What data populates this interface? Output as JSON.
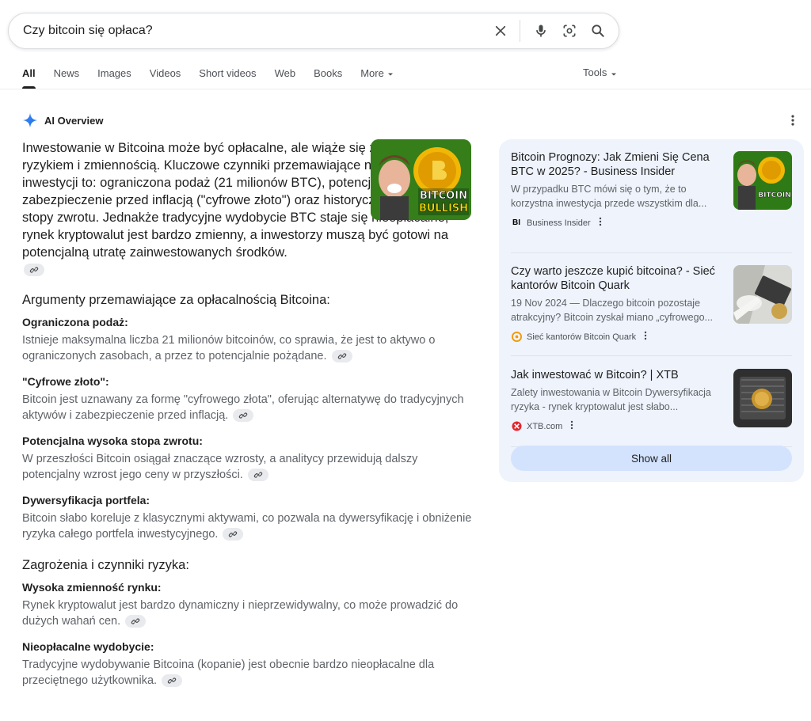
{
  "search": {
    "query": "Czy bitcoin się opłaca?"
  },
  "tabs": [
    "All",
    "News",
    "Images",
    "Videos",
    "Short videos",
    "Web",
    "Books",
    "More"
  ],
  "tools_label": "Tools",
  "ai_overview": {
    "label": "AI Overview",
    "intro": "Inwestowanie w Bitcoina może być opłacalne, ale wiąże się z wysokim ryzykiem i zmiennością. Kluczowe czynniki przemawiające na korzyść inwestycji to: ograniczona podaż (21 milionów BTC), potencjał jako zabezpieczenie przed inflacją (\"cyfrowe złoto\") oraz historyczne wysokie stopy zwrotu. Jednakże tradycyjne wydobycie BTC staje się nieopłacalne, rynek kryptowalut jest bardzo zmienny, a inwestorzy muszą być gotowi na potencjalną utratę zainwestowanych środków.",
    "thumb_text": "BITCOIN BULLISH",
    "sections": [
      {
        "heading": "Argumenty przemawiające za opłacalnością Bitcoina:",
        "items": [
          {
            "title": "Ograniczona podaż:",
            "body": "Istnieje maksymalna liczba 21 milionów bitcoinów, co sprawia, że jest to aktywo o ograniczonych zasobach, a przez to potencjalnie pożądane."
          },
          {
            "title": "\"Cyfrowe złoto\":",
            "body": "Bitcoin jest uznawany za formę \"cyfrowego złota\", oferując alternatywę do tradycyjnych aktywów i zabezpieczenie przed inflacją."
          },
          {
            "title": "Potencjalna wysoka stopa zwrotu:",
            "body": "W przeszłości Bitcoin osiągał znaczące wzrosty, a analitycy przewidują dalszy potencjalny wzrost jego ceny w przyszłości."
          },
          {
            "title": "Dywersyfikacja portfela:",
            "body": "Bitcoin słabo koreluje z klasycznymi aktywami, co pozwala na dywersyfikację i obniżenie ryzyka całego portfela inwestycyjnego."
          }
        ]
      },
      {
        "heading": "Zagrożenia i czynniki ryzyka:",
        "items": [
          {
            "title": "Wysoka zmienność rynku:",
            "body": "Rynek kryptowalut jest bardzo dynamiczny i nieprzewidywalny, co może prowadzić do dużych wahań cen."
          },
          {
            "title": "Nieopłacalne wydobycie:",
            "body": "Tradycyjne wydobywanie Bitcoina (kopanie) jest obecnie bardzo nieopłacalne dla przeciętnego użytkownika."
          }
        ]
      }
    ]
  },
  "sources": [
    {
      "title": "Bitcoin Prognozy: Jak Zmieni Się Cena BTC w 2025? - Business Insider",
      "snippet": "W przypadku BTC mówi się o tym, że to korzystna inwestycja przede wszystkim dla...",
      "source": "Business Insider",
      "favicon_text": "BI",
      "thumb_text": "BITCOIN"
    },
    {
      "title": "Czy warto jeszcze kupić bitcoina? - Sieć kantorów Bitcoin Quark",
      "snippet": "19 Nov 2024 — Dlaczego bitcoin pozostaje atrakcyjny? Bitcoin zyskał miano „cyfrowego...",
      "source": "Sieć kantorów Bitcoin Quark"
    },
    {
      "title": "Jak inwestować w Bitcoin? | XTB",
      "snippet": "Zalety inwestowania w Bitcoin Dywersyfikacja ryzyka - rynek kryptowalut jest słabo...",
      "source": "XTB.com"
    }
  ],
  "show_all_label": "Show all",
  "colors": {
    "accent": "#1a73e8",
    "panel_bg": "#eef3fc",
    "show_all_bg": "#d3e3fd",
    "xtb_red": "#e3262f",
    "quark_orange": "#f29900"
  }
}
